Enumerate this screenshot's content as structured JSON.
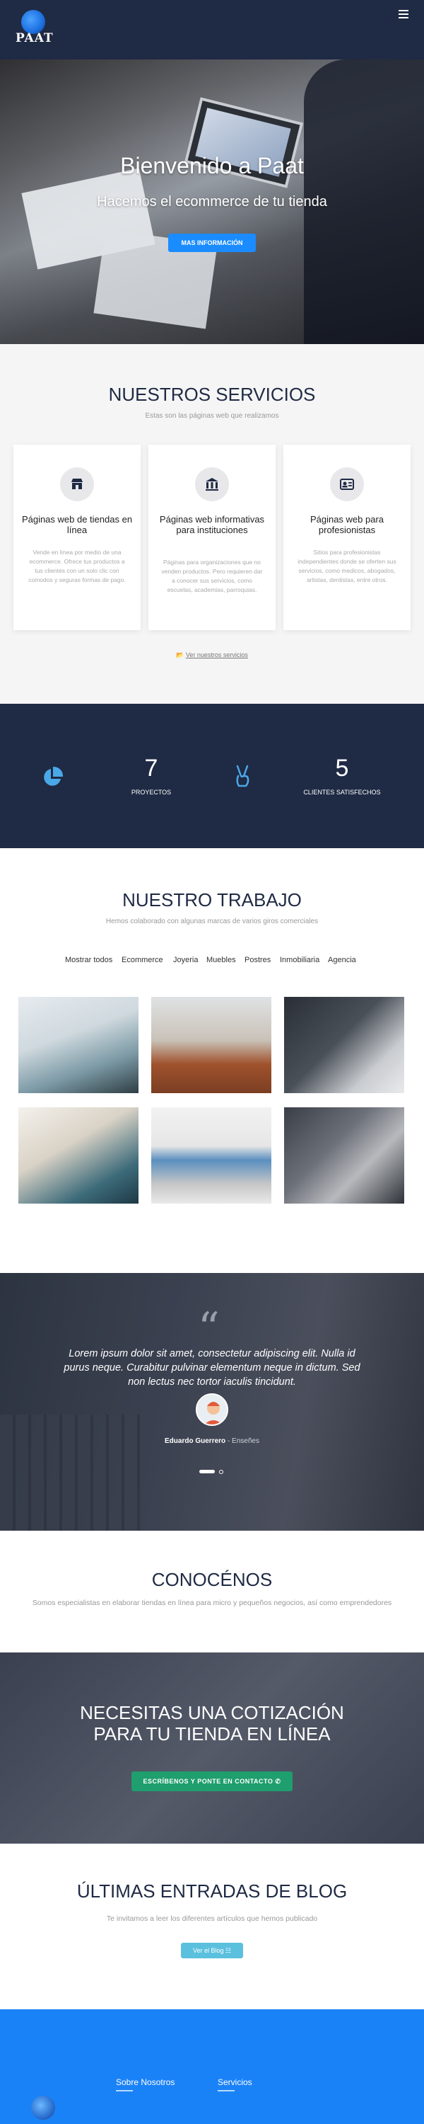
{
  "header": {
    "logo_text": "PAAT",
    "menu_icon": "hamburger-icon"
  },
  "hero": {
    "title": "Bienvenido a Paat",
    "subtitle": "Hacemos el ecommerce de tu tienda",
    "button": "MAS INFORMACIÓN"
  },
  "services": {
    "title": "NUESTROS SERVICIOS",
    "subtitle": "Estas son las páginas web que realizamos",
    "cards": [
      {
        "icon": "store-icon",
        "title": "Páginas web de tiendas en línea",
        "text": "Vende en línea por medio de una ecommerce. Ofrece tus productos a tus clientes con un solo clic con comodos y seguras formas de pago."
      },
      {
        "icon": "institution-icon",
        "title": "Páginas web informativas para instituciones",
        "text": "Páginas para organizaciones que no venden productos. Pero requieren dar a conocer sus servicios, como escuelas, academias, parroquias."
      },
      {
        "icon": "id-card-icon",
        "title": "Páginas web para profesionistas",
        "text": "Sitios para profesionistas independientes donde se oferten sus servicios, como medicos, abogados, artistas, dentistas, entre otros."
      }
    ],
    "link": "Ver nuestros servicios"
  },
  "stats": {
    "items": [
      {
        "icon": "pie-chart-icon",
        "number": "7",
        "label": "PROYECTOS"
      },
      {
        "icon": "victory-hand-icon",
        "number": "5",
        "label": "CLIENTES SATISFECHOS"
      }
    ]
  },
  "work": {
    "title": "NUESTRO TRABAJO",
    "subtitle": "Hemos colaborado con algunas marcas de varios giros comerciales",
    "filters": [
      "Mostrar todos",
      "Ecommerce",
      "Joyeria",
      "Muebles",
      "Postres",
      "Inmobiliaria",
      "Agencia"
    ]
  },
  "testimonial": {
    "quote": "Lorem ipsum dolor sit amet, consectetur adipiscing elit. Nulla id purus neque. Curabitur pulvinar elementum neque in dictum. Sed non lectus nec tortor iaculis tincidunt.",
    "author": "Eduardo Guerrero",
    "role": "Enseñes"
  },
  "about": {
    "title": "CONOCÉNOS",
    "text": "Somos especialistas en elaborar tiendas en línea para micro y pequeños negocios, así como emprendedores"
  },
  "cta": {
    "title_line1": "NECESITAS UNA COTIZACIÓN",
    "title_line2": "PARA TU TIENDA EN LÍNEA",
    "button": "ESCRÍBENOS Y PONTE EN CONTACTO"
  },
  "blog": {
    "title": "ÚLTIMAS ENTRADAS DE BLOG",
    "subtitle": "Te invitamos a leer los diferentes artículos que hemos publicado",
    "button": "Ver el Blog"
  },
  "footer": {
    "col1": "Sobre Nosotros",
    "col2": "Servicios"
  },
  "colors": {
    "navy": "#1f2a44",
    "accent": "#1a8cff",
    "green": "#1f9e6e",
    "footer_blue": "#1a82f7"
  }
}
